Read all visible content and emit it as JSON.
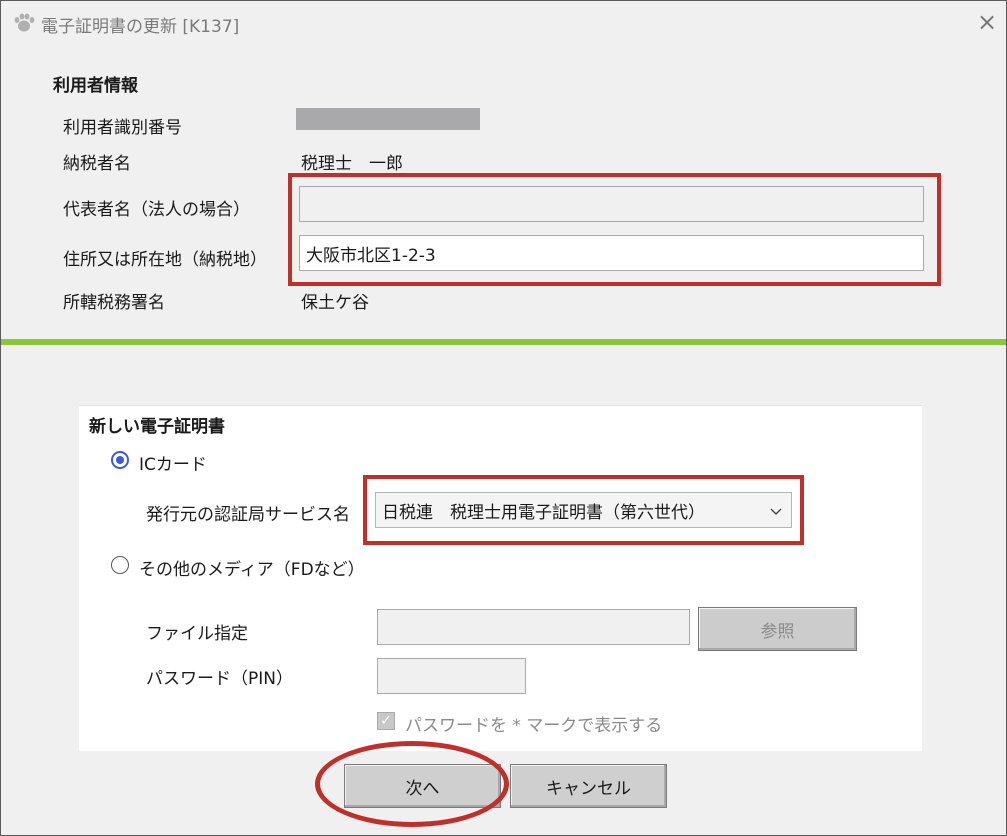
{
  "window": {
    "title": "電子証明書の更新 [K137]",
    "close_icon": "×"
  },
  "user_info": {
    "heading": "利用者情報",
    "id_label": "利用者識別番号",
    "id_value": "",
    "taxpayer_label": "納税者名",
    "taxpayer_value": "税理士　一郎",
    "representative_label": "代表者名（法人の場合）",
    "representative_value": "",
    "address_label": "住所又は所在地（納税地）",
    "address_value": "大阪市北区1-2-3",
    "tax_office_label": "所轄税務署名",
    "tax_office_value": "保土ケ谷"
  },
  "new_cert": {
    "heading": "新しい電子証明書",
    "ic_card_label": "ICカード",
    "ic_card_selected": true,
    "issuer_label": "発行元の認証局サービス名",
    "issuer_value": "日税連　税理士用電子証明書（第六世代）",
    "other_media_label": "その他のメディア（FDなど）",
    "other_media_selected": false,
    "file_label": "ファイル指定",
    "file_value": "",
    "browse_label": "参照",
    "password_label": "パスワード（PIN）",
    "password_value": "",
    "mask_checkbox_label": "パスワードを * マークで表示する",
    "mask_checkbox_checked": true
  },
  "footer": {
    "next_label": "次へ",
    "cancel_label": "キャンセル"
  },
  "colors": {
    "highlight": "#c0302a",
    "divider": "#8bc63f",
    "radio_accent": "#3b5bdb"
  }
}
